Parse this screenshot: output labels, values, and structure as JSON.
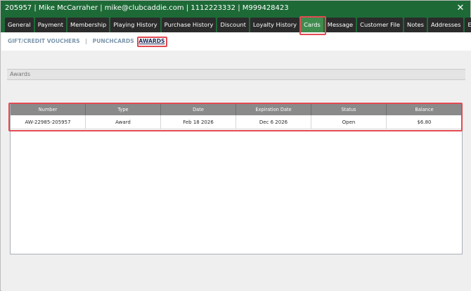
{
  "window": {
    "title": "205957 | Mike McCarraher | mike@clubcaddie.com | 1112223332 | M999428423",
    "close_glyph": "✕"
  },
  "tabs": [
    {
      "label": "General",
      "active": false
    },
    {
      "label": "Payment",
      "active": false
    },
    {
      "label": "Membership",
      "active": false
    },
    {
      "label": "Playing History",
      "active": false
    },
    {
      "label": "Purchase History",
      "active": false
    },
    {
      "label": "Discount",
      "active": false
    },
    {
      "label": "Loyalty History",
      "active": false
    },
    {
      "label": "Cards",
      "active": true
    },
    {
      "label": "Message",
      "active": false
    },
    {
      "label": "Customer File",
      "active": false
    },
    {
      "label": "Notes",
      "active": false
    },
    {
      "label": "Addresses",
      "active": false
    },
    {
      "label": "Emails",
      "active": false
    }
  ],
  "subnav": {
    "gift_vouchers": "GIFT/CREDIT VOUCHERS",
    "separator": "|",
    "punchcards": "PUNCHCARDS",
    "awards": "AWARDS"
  },
  "section": {
    "title": "Awards"
  },
  "awards_table": {
    "columns": [
      "Number",
      "Type",
      "Date",
      "Expiration Date",
      "Status",
      "Balance"
    ],
    "rows": [
      [
        "AW-22985-205957",
        "Award",
        "Feb 18 2026",
        "Dec 6 2026",
        "Open",
        "$6.80"
      ]
    ]
  },
  "colors": {
    "title_bar": "#1d6a37",
    "tab_bg": "#2b2b2b",
    "tab_active": "#3f8c4e",
    "highlight": "#e34a52",
    "header_bg": "#8a8a8a"
  }
}
